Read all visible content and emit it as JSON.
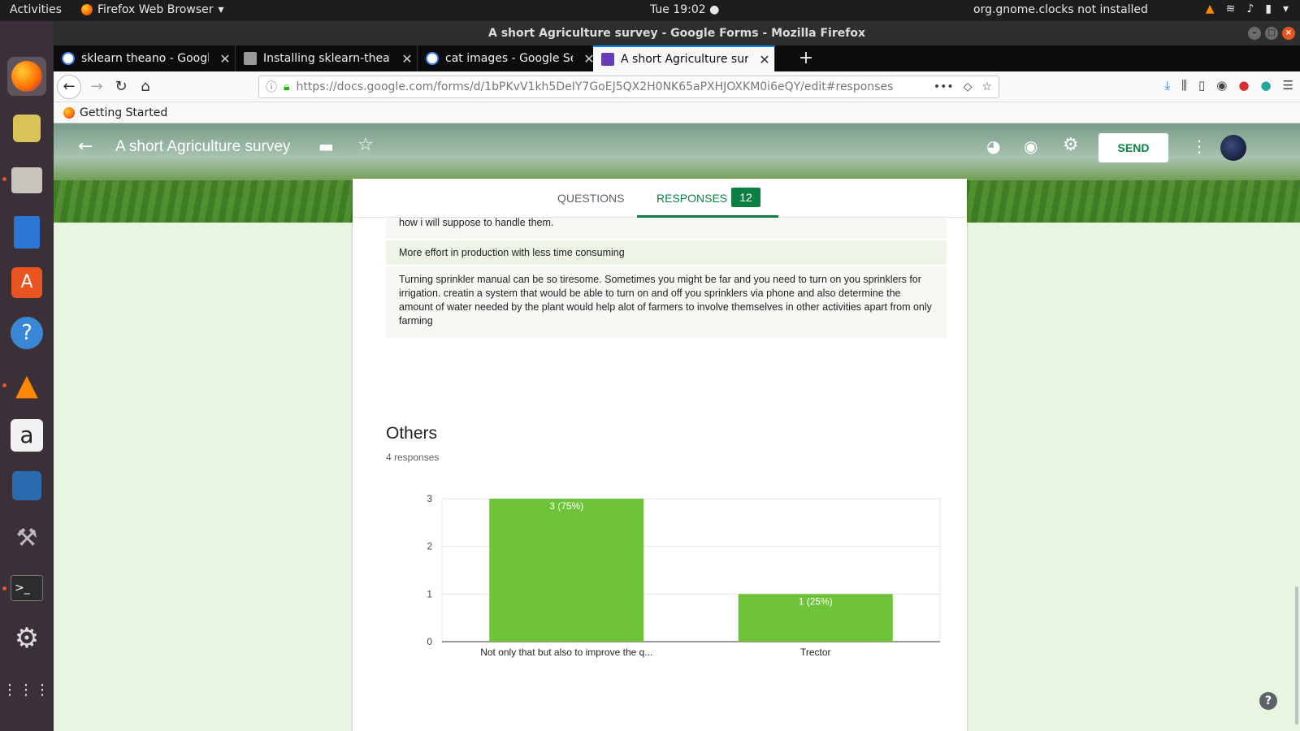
{
  "topbar": {
    "activities": "Activities",
    "app_name": "Firefox Web Browser",
    "clock": "Tue 19:02",
    "status": "org.gnome.clocks not installed"
  },
  "window": {
    "title": "A short Agriculture survey - Google Forms - Mozilla Firefox"
  },
  "tabs": [
    {
      "title": "sklearn theano - Google S",
      "icon": "google-icon"
    },
    {
      "title": "Installing sklearn-theano",
      "icon": "page-icon"
    },
    {
      "title": "cat images - Google Sear",
      "icon": "google-icon"
    },
    {
      "title": "A short Agriculture surve",
      "icon": "forms-icon"
    }
  ],
  "navbar": {
    "url": "https://docs.google.com/forms/d/1bPKvV1kh5DeIY7GoEJ5QX2H0NK65aPXHJOXKM0i6eQY/edit#responses"
  },
  "bookmarks": {
    "getting_started": "Getting Started"
  },
  "form": {
    "title": "A short Agriculture survey",
    "send_label": "SEND",
    "tab_questions": "QUESTIONS",
    "tab_responses": "RESPONSES",
    "responses_count": "12",
    "accent_color": "#0b8043"
  },
  "responses_text": [
    "how i will suppose to handle them.",
    "More effort in production with less time consuming",
    "Turning sprinkler manual can be so tiresome. Sometimes you might be far and you need to turn on you sprinklers for irrigation. creatin a system that would be able to turn on and off you sprinklers via phone and also determine the amount of water needed by the plant would help alot of farmers to involve themselves in other activities apart from only farming"
  ],
  "question": {
    "title": "Others",
    "responses": "4 responses"
  },
  "chart_data": {
    "type": "bar",
    "categories": [
      "Not only that but also to improve the q...",
      "Trector"
    ],
    "values": [
      3,
      1
    ],
    "data_labels": [
      "3 (75%)",
      "1 (25%)"
    ],
    "ylim": [
      0,
      3
    ],
    "yticks": [
      "0",
      "1",
      "2",
      "3"
    ],
    "grid": true,
    "bar_color": "#6fc33b"
  }
}
